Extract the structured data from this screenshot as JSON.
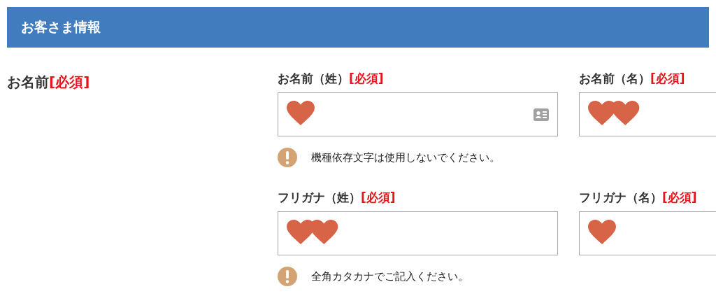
{
  "header": {
    "title": "お客さま情報"
  },
  "section": {
    "label": "お名前",
    "required": "[必須]"
  },
  "rows": [
    {
      "fields": [
        {
          "label": "お名前（姓）",
          "required": "[必須]",
          "card_icon": true
        },
        {
          "label": "お名前（名）",
          "required": "[必須]"
        }
      ],
      "note": "機種依存文字は使用しないでください。"
    },
    {
      "fields": [
        {
          "label": "フリガナ（姓）",
          "required": "[必須]",
          "card_icon": false
        },
        {
          "label": "フリガナ（名）",
          "required": "[必須]"
        }
      ],
      "note": "全角カタカナでご記入ください。"
    }
  ]
}
